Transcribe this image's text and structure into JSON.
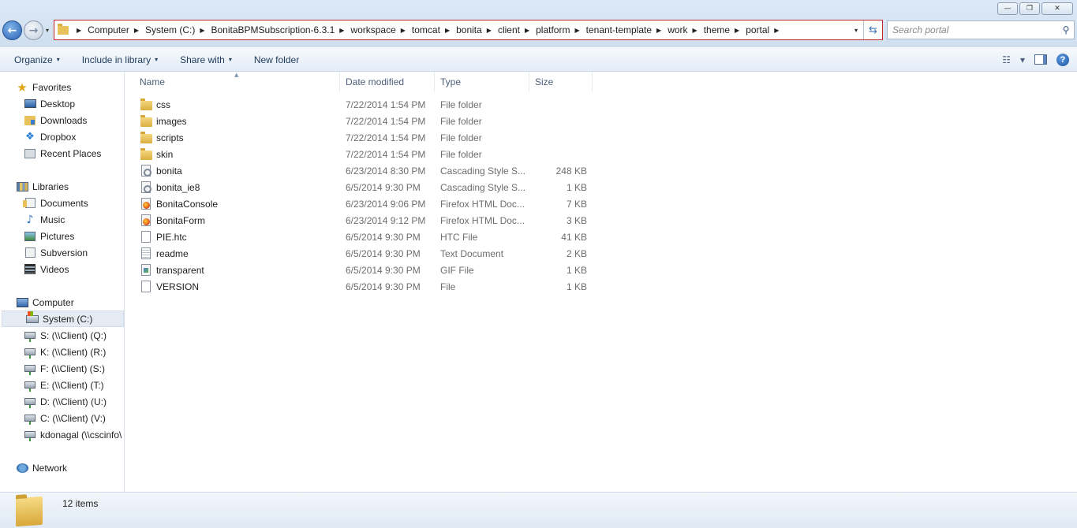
{
  "window": {
    "controls": {
      "minimize": "—",
      "maximize": "❐",
      "close": "✕"
    }
  },
  "nav": {
    "back_glyph": "←",
    "forward_glyph": "→",
    "history_dropdown": "▾"
  },
  "address": {
    "separator": "▶",
    "crumbs": [
      "Computer",
      "System (C:)",
      "BonitaBPMSubscription-6.3.1",
      "workspace",
      "tomcat",
      "bonita",
      "client",
      "platform",
      "tenant-template",
      "work",
      "theme",
      "portal"
    ],
    "dropdown": "▾",
    "refresh": "⇆"
  },
  "search": {
    "placeholder": "Search portal",
    "icon": "⚲"
  },
  "commands": {
    "organize": "Organize",
    "include_in_library": "Include in library",
    "share_with": "Share with",
    "new_folder": "New folder",
    "dd": "▾",
    "view_icon": "☷",
    "help": "?"
  },
  "sidebar": {
    "favorites": "Favorites",
    "favorites_items": [
      "Desktop",
      "Downloads",
      "Dropbox",
      "Recent Places"
    ],
    "libraries": "Libraries",
    "libraries_items": [
      "Documents",
      "Music",
      "Pictures",
      "Subversion",
      "Videos"
    ],
    "computer": "Computer",
    "computer_items": [
      "System (C:)",
      "S: (\\\\Client) (Q:)",
      "K: (\\\\Client) (R:)",
      "F: (\\\\Client) (S:)",
      "E: (\\\\Client) (T:)",
      "D: (\\\\Client) (U:)",
      "C: (\\\\Client) (V:)",
      "kdonagal (\\\\cscinfo\\"
    ],
    "network": "Network"
  },
  "columns": {
    "name": "Name",
    "date": "Date modified",
    "type": "Type",
    "size": "Size",
    "sort_indicator": "▲"
  },
  "files": [
    {
      "name": "css",
      "date": "7/22/2014 1:54 PM",
      "type": "File folder",
      "size": "",
      "kind": "folder"
    },
    {
      "name": "images",
      "date": "7/22/2014 1:54 PM",
      "type": "File folder",
      "size": "",
      "kind": "folder"
    },
    {
      "name": "scripts",
      "date": "7/22/2014 1:54 PM",
      "type": "File folder",
      "size": "",
      "kind": "folder"
    },
    {
      "name": "skin",
      "date": "7/22/2014 1:54 PM",
      "type": "File folder",
      "size": "",
      "kind": "folder"
    },
    {
      "name": "bonita",
      "date": "6/23/2014 8:30 PM",
      "type": "Cascading Style S...",
      "size": "248 KB",
      "kind": "css"
    },
    {
      "name": "bonita_ie8",
      "date": "6/5/2014 9:30 PM",
      "type": "Cascading Style S...",
      "size": "1 KB",
      "kind": "css"
    },
    {
      "name": "BonitaConsole",
      "date": "6/23/2014 9:06 PM",
      "type": "Firefox HTML Doc...",
      "size": "7 KB",
      "kind": "html"
    },
    {
      "name": "BonitaForm",
      "date": "6/23/2014 9:12 PM",
      "type": "Firefox HTML Doc...",
      "size": "3 KB",
      "kind": "html"
    },
    {
      "name": "PIE.htc",
      "date": "6/5/2014 9:30 PM",
      "type": "HTC File",
      "size": "41 KB",
      "kind": "doc"
    },
    {
      "name": "readme",
      "date": "6/5/2014 9:30 PM",
      "type": "Text Document",
      "size": "2 KB",
      "kind": "txt"
    },
    {
      "name": "transparent",
      "date": "6/5/2014 9:30 PM",
      "type": "GIF File",
      "size": "1 KB",
      "kind": "gif"
    },
    {
      "name": "VERSION",
      "date": "6/5/2014 9:30 PM",
      "type": "File",
      "size": "1 KB",
      "kind": "doc"
    }
  ],
  "status": {
    "item_count": "12 items"
  },
  "colors": {
    "address_highlight": "#c4262a",
    "selection": "#e5ebf3",
    "link_blue": "#1e395b"
  }
}
